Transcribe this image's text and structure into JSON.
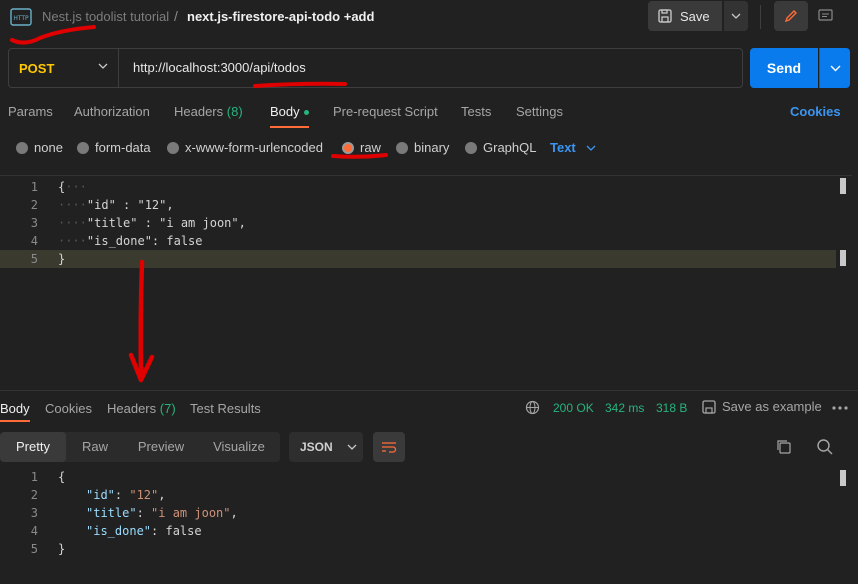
{
  "header": {
    "breadcrumb_parent": "Nest.js todolist tutorial",
    "breadcrumb_sep": "/",
    "breadcrumb_current": "next.js-firestore-api-todo +add",
    "save_label": "Save"
  },
  "request": {
    "method": "POST",
    "url": "http://localhost:3000/api/todos",
    "send_label": "Send"
  },
  "req_tabs": {
    "params": "Params",
    "authorization": "Authorization",
    "headers": "Headers",
    "headers_count": "(8)",
    "body": "Body",
    "prerequest": "Pre-request Script",
    "tests": "Tests",
    "settings": "Settings",
    "cookies": "Cookies"
  },
  "body_options": {
    "none": "none",
    "form_data": "form-data",
    "urlencoded": "x-www-form-urlencoded",
    "raw": "raw",
    "binary": "binary",
    "graphql": "GraphQL",
    "text_format": "Text",
    "selected": "raw"
  },
  "request_body": {
    "line_numbers": [
      "1",
      "2",
      "3",
      "4",
      "5"
    ],
    "lines": [
      "{",
      "\"id\" : \"12\",",
      "\"title\" : \"i am joon\",",
      "\"is_done\": false",
      "}"
    ]
  },
  "response": {
    "tabs": {
      "body": "Body",
      "cookies": "Cookies",
      "headers": "Headers",
      "headers_count": "(7)",
      "test_results": "Test Results"
    },
    "status": "200 OK",
    "time": "342 ms",
    "size": "318 B",
    "save_example": "Save as example",
    "views": {
      "pretty": "Pretty",
      "raw": "Raw",
      "preview": "Preview",
      "visualize": "Visualize"
    },
    "format": "JSON",
    "line_numbers": [
      "1",
      "2",
      "3",
      "4",
      "5"
    ],
    "body": {
      "open": "{",
      "id_key": "\"id\"",
      "id_val": "\"12\"",
      "title_key": "\"title\"",
      "title_val": "\"i am joon\"",
      "done_key": "\"is_done\"",
      "done_val": "false",
      "close": "}"
    }
  },
  "colors": {
    "accent": "#ff6c37",
    "send": "#097bed",
    "method": "#ffc800",
    "success": "#26b47f",
    "link": "#3b96f2",
    "annotation": "#e00000"
  },
  "icons": [
    "http-icon",
    "save-icon",
    "chevron-down-icon",
    "pencil-icon",
    "comment-icon",
    "globe-icon",
    "more-icon",
    "wrap-icon",
    "copy-icon",
    "search-icon"
  ]
}
